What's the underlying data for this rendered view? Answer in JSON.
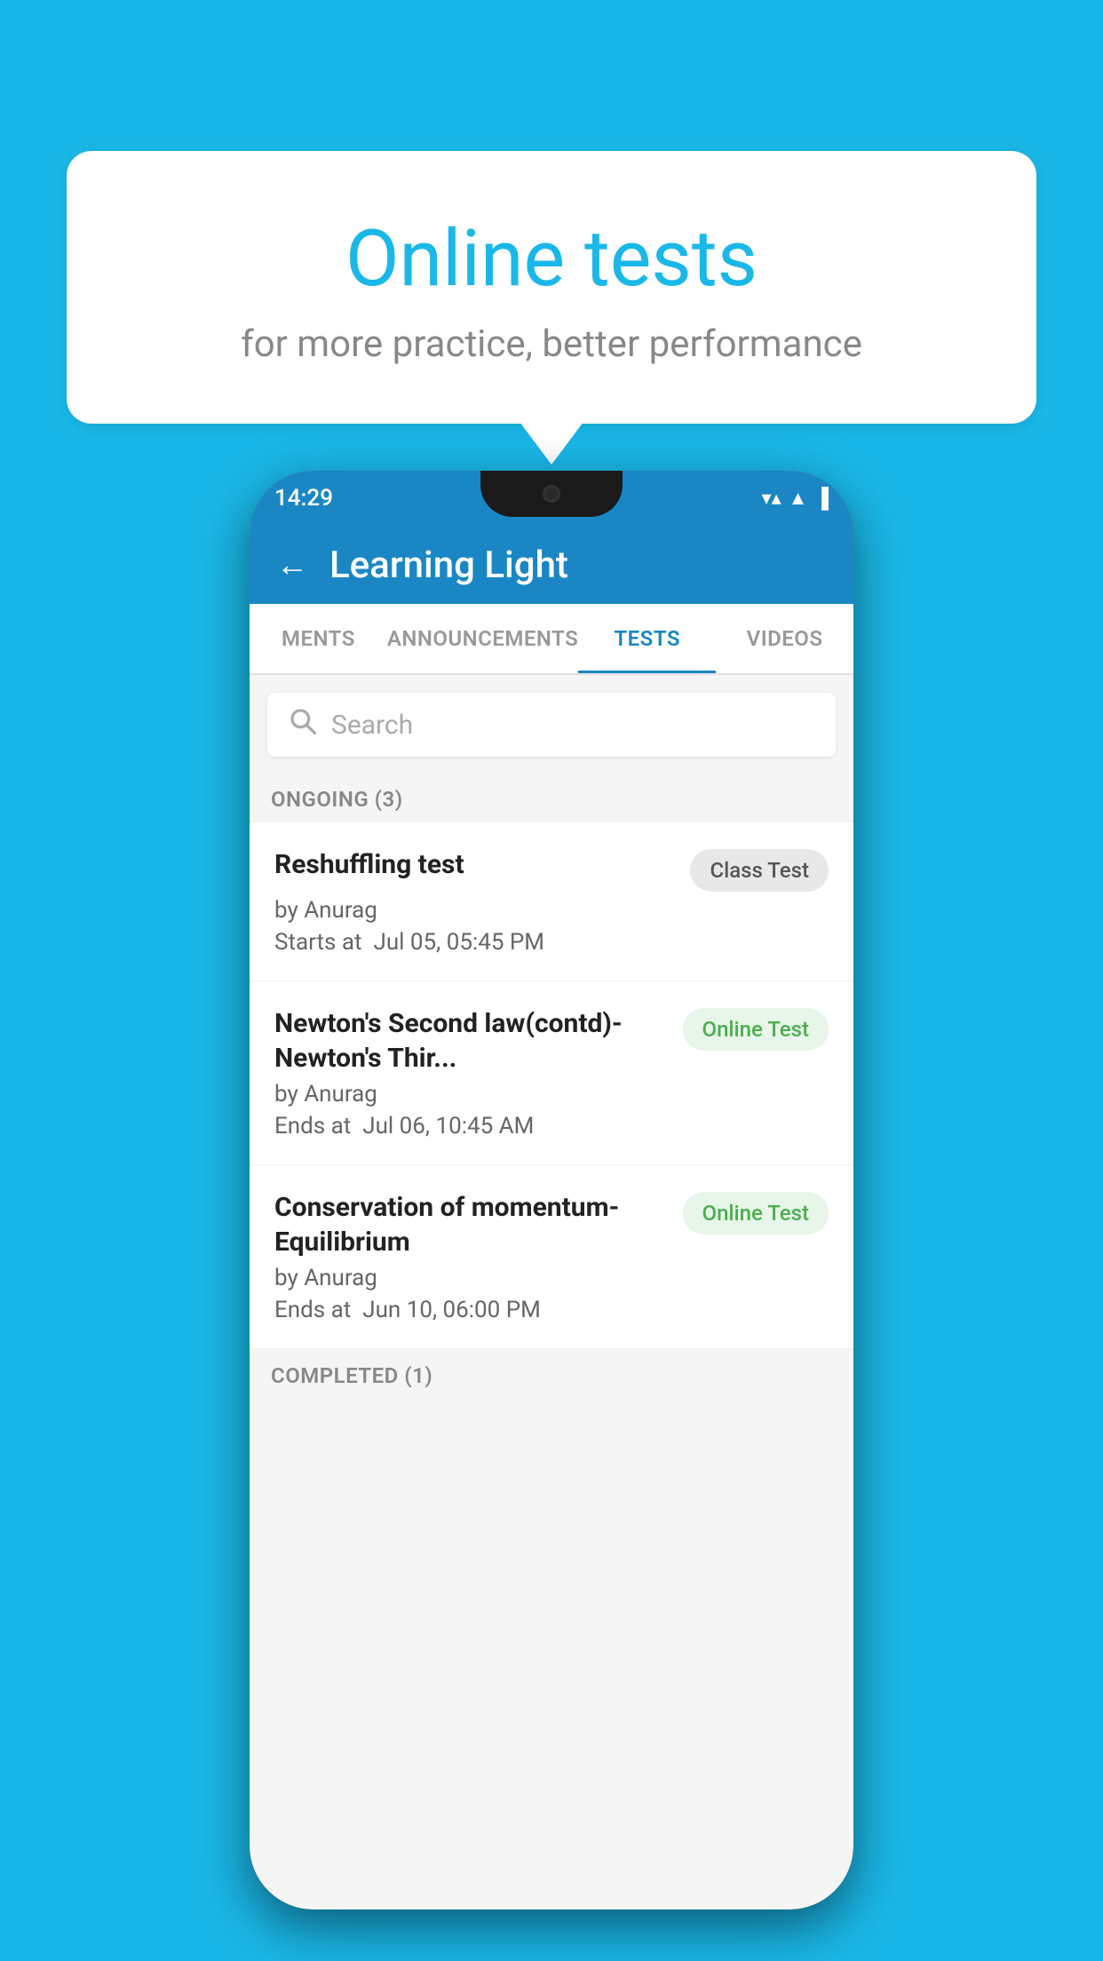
{
  "background_color": "#1ab8e8",
  "bubble": {
    "title": "Online tests",
    "subtitle": "for more practice, better performance"
  },
  "phone": {
    "status_bar": {
      "time": "14:29",
      "wifi": "▼▲",
      "signal": "▲",
      "battery": "▪"
    },
    "app_bar": {
      "back_label": "←",
      "title": "Learning Light"
    },
    "tabs": [
      {
        "label": "MENTS",
        "active": false
      },
      {
        "label": "ANNOUNCEMENTS",
        "active": false
      },
      {
        "label": "TESTS",
        "active": true
      },
      {
        "label": "VIDEOS",
        "active": false
      }
    ],
    "search": {
      "placeholder": "Search"
    },
    "ongoing_section": {
      "label": "ONGOING (3)"
    },
    "tests": [
      {
        "name": "Reshuffling test",
        "badge": "Class Test",
        "badge_type": "class",
        "author": "by Anurag",
        "date_label": "Starts at",
        "date": "Jul 05, 05:45 PM"
      },
      {
        "name": "Newton's Second law(contd)-Newton's Thir...",
        "badge": "Online Test",
        "badge_type": "online",
        "author": "by Anurag",
        "date_label": "Ends at",
        "date": "Jul 06, 10:45 AM"
      },
      {
        "name": "Conservation of momentum-Equilibrium",
        "badge": "Online Test",
        "badge_type": "online",
        "author": "by Anurag",
        "date_label": "Ends at",
        "date": "Jun 10, 06:00 PM"
      }
    ],
    "completed_section": {
      "label": "COMPLETED (1)"
    }
  }
}
